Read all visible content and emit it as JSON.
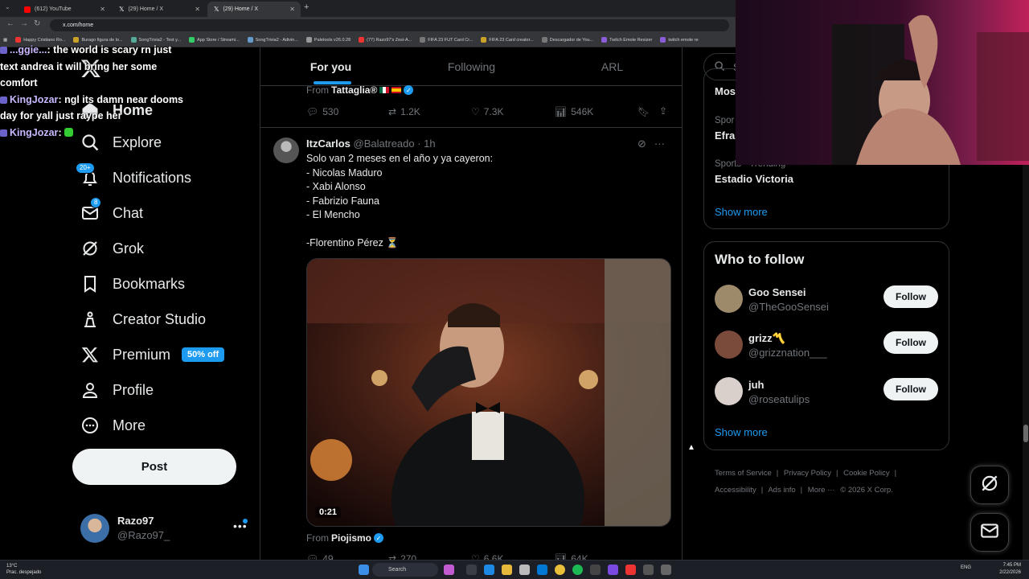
{
  "browser": {
    "tabs": [
      {
        "title": "(612) YouTube",
        "active": false,
        "color": "#ff0000"
      },
      {
        "title": "(29) Home / X",
        "active": false,
        "color": "#ffffff"
      },
      {
        "title": "(29) Home / X",
        "active": true,
        "color": "#ffffff"
      }
    ],
    "url": "x.com/home",
    "bookmarks": [
      "Happy Cristiano Ro...",
      "Burago figura de lo...",
      "SongTrivia2 - Test y...",
      "App Store / Streami...",
      "SongTrivia2 - Adivin...",
      "Paletools v26.0.28",
      "(77) Razo97's Zesi-A...",
      "FIFA 23 FUT Card Cr...",
      "FIFA 23 Card creator...",
      "Descargador de You...",
      "Twitch Emote Resizer",
      "twitch emote re"
    ]
  },
  "chat": [
    {
      "user": "",
      "text": ": the world is scary rn just text andrea it will bring her some comfort",
      "user_partial": "...ggie..."
    },
    {
      "user": "KingJozar",
      "text": ": ngl its damn near dooms day for yall just raype her"
    },
    {
      "user": "KingJozar",
      "text": ":"
    }
  ],
  "nav": {
    "items": [
      {
        "label": "Home",
        "icon": "home-icon"
      },
      {
        "label": "Explore",
        "icon": "search-icon"
      },
      {
        "label": "Notifications",
        "icon": "bell-icon",
        "badge": "20+"
      },
      {
        "label": "Chat",
        "icon": "mail-icon",
        "badge": "8"
      },
      {
        "label": "Grok",
        "icon": "grok-icon"
      },
      {
        "label": "Bookmarks",
        "icon": "bookmark-icon"
      },
      {
        "label": "Creator Studio",
        "icon": "creator-icon"
      },
      {
        "label": "Premium",
        "icon": "x-logo-icon",
        "pill": "50% off"
      },
      {
        "label": "Profile",
        "icon": "person-icon"
      },
      {
        "label": "More",
        "icon": "more-circle-icon"
      }
    ],
    "post_label": "Post"
  },
  "account": {
    "name": "Razo97",
    "handle": "@Razo97_"
  },
  "feed": {
    "tabs": [
      "For you",
      "Following",
      "ARL"
    ],
    "active_tab": 0,
    "prev_post": {
      "from_label": "From",
      "from_name": "Tattaglia®",
      "stats": {
        "replies": "530",
        "reposts": "1.2K",
        "likes": "7.3K",
        "views": "546K"
      }
    },
    "post": {
      "name": "ItzCarlos",
      "handle": "@Balatreado",
      "time": "· 1h",
      "text": "Solo van 2 meses en el año y ya cayeron:\n- Nicolas Maduro\n- Xabi Alonso\n- Fabrizio Fauna\n- El Mencho\n\n-Florentino Pérez ⏳",
      "video_duration": "0:21",
      "from_label": "From",
      "from_name": "Piojismo",
      "stats": {
        "replies": "49",
        "reposts": "270",
        "likes": "6.6K",
        "views": "64K"
      }
    }
  },
  "sidebar": {
    "search_placeholder": "Se",
    "trends": [
      {
        "meta": "",
        "title": "Mos"
      },
      {
        "meta": "Spor",
        "title": "Efra"
      },
      {
        "meta": "Sports · Trending",
        "title": "Estadio Victoria"
      }
    ],
    "show_more": "Show more",
    "who_to_follow": {
      "title": "Who to follow",
      "people": [
        {
          "name": "Goo Sensei",
          "handle": "@TheGooSensei",
          "button": "Follow",
          "color": "#9c8a6a"
        },
        {
          "name": "grizz〽️",
          "handle": "@grizznation___",
          "button": "Follow",
          "color": "#7a4a3a"
        },
        {
          "name": "juh",
          "handle": "@roseatulips",
          "button": "Follow",
          "color": "#d9d0cc"
        }
      ],
      "show_more": "Show more"
    },
    "footer": [
      "Terms of Service",
      "Privacy Policy",
      "Cookie Policy",
      "Accessibility",
      "Ads info",
      "More ···",
      "© 2026 X Corp."
    ]
  },
  "taskbar": {
    "weather_temp": "13°C",
    "weather_desc": "Prac. despejado",
    "search": "Search",
    "lang": "ENG",
    "time": "7:45 PM",
    "date": "2/22/2026"
  },
  "colors": {
    "accent": "#1d9bf0",
    "background": "#000000",
    "border": "#2f3336",
    "muted": "#71767b"
  }
}
